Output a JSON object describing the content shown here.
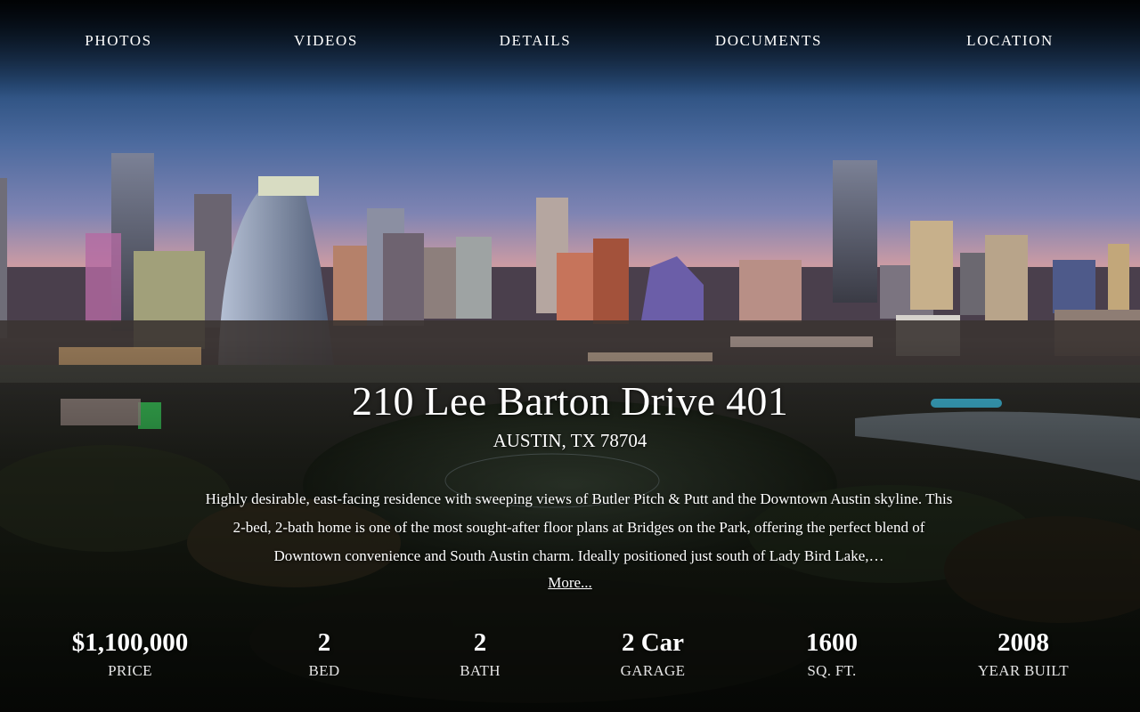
{
  "nav": {
    "items": [
      {
        "label": "PHOTOS"
      },
      {
        "label": "VIDEOS"
      },
      {
        "label": "DETAILS"
      },
      {
        "label": "DOCUMENTS"
      },
      {
        "label": "LOCATION"
      }
    ]
  },
  "listing": {
    "address": "210 Lee Barton Drive 401",
    "city_line": "AUSTIN, TX 78704",
    "description": "Highly desirable, east-facing residence with sweeping views of Butler Pitch & Putt and the Downtown Austin skyline. This 2-bed, 2-bath home is one of the most sought-after floor plans at Bridges on the Park, offering the perfect blend of Downtown convenience and South Austin charm. Ideally positioned just south of Lady Bird Lake,…",
    "more_label": "More..."
  },
  "stats": [
    {
      "value": "$1,100,000",
      "label": "PRICE"
    },
    {
      "value": "2",
      "label": "BED"
    },
    {
      "value": "2",
      "label": "BATH"
    },
    {
      "value": "2 Car",
      "label": "GARAGE"
    },
    {
      "value": "1600",
      "label": "SQ. FT."
    },
    {
      "value": "2008",
      "label": "YEAR BUILT"
    }
  ]
}
